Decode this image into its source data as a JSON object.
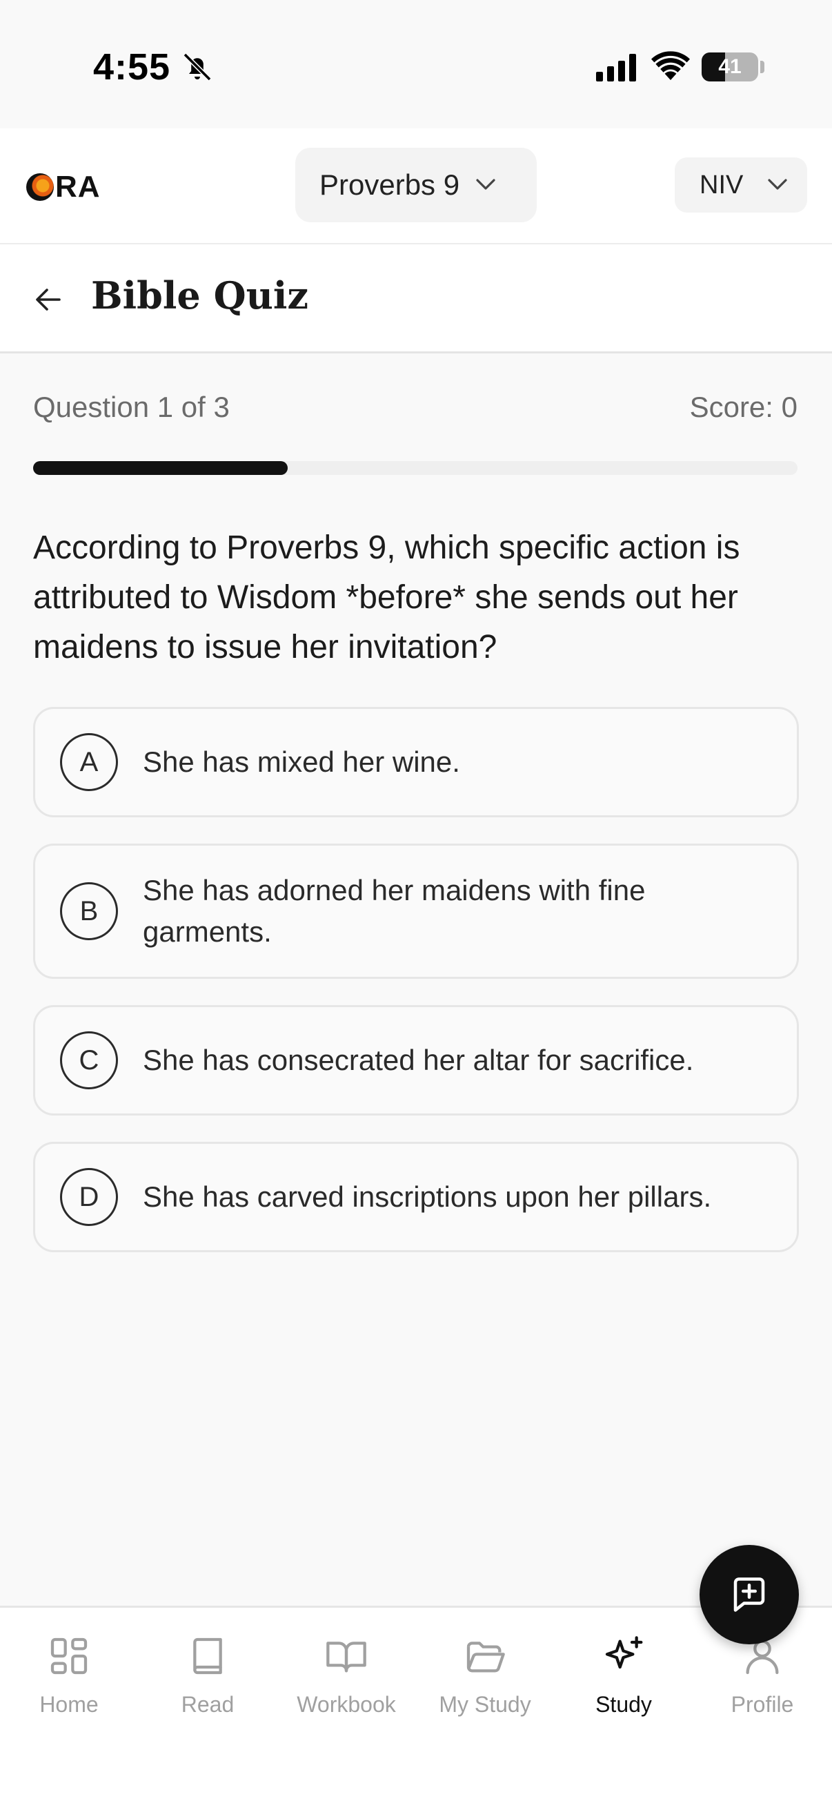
{
  "status_bar": {
    "time": "4:55",
    "battery_level": "41",
    "battery_fraction": 0.41
  },
  "header": {
    "logo_text": "RA",
    "book_selector": "Proverbs 9",
    "version_selector": "NIV"
  },
  "title_bar": {
    "title": "Bible Quiz"
  },
  "quiz": {
    "question_counter": "Question 1 of 3",
    "score": "Score: 0",
    "progress_fraction": 0.3333,
    "question": "According to Proverbs 9, which specific action is attributed to Wisdom *before* she sends out her maidens to issue her invitation?",
    "options": [
      {
        "letter": "A",
        "text": "She has mixed her wine."
      },
      {
        "letter": "B",
        "text": "She has adorned her maidens with fine garments."
      },
      {
        "letter": "C",
        "text": "She has consecrated her altar for sacrifice."
      },
      {
        "letter": "D",
        "text": "She has carved inscriptions upon her pillars."
      }
    ]
  },
  "bottom_nav": {
    "items": [
      {
        "label": "Home",
        "icon": "grid-icon",
        "active": false
      },
      {
        "label": "Read",
        "icon": "book-icon",
        "active": false
      },
      {
        "label": "Workbook",
        "icon": "open-book-icon",
        "active": false
      },
      {
        "label": "My Study",
        "icon": "folder-icon",
        "active": false
      },
      {
        "label": "Study",
        "icon": "sparkles-icon",
        "active": true
      },
      {
        "label": "Profile",
        "icon": "user-icon",
        "active": false
      }
    ]
  },
  "fab": {
    "icon": "chat-plus-icon"
  },
  "colors": {
    "background": "#f9f9f9",
    "accent": "#111111",
    "muted_text": "#6b6b6b",
    "inactive_nav": "#a0a0a0"
  }
}
